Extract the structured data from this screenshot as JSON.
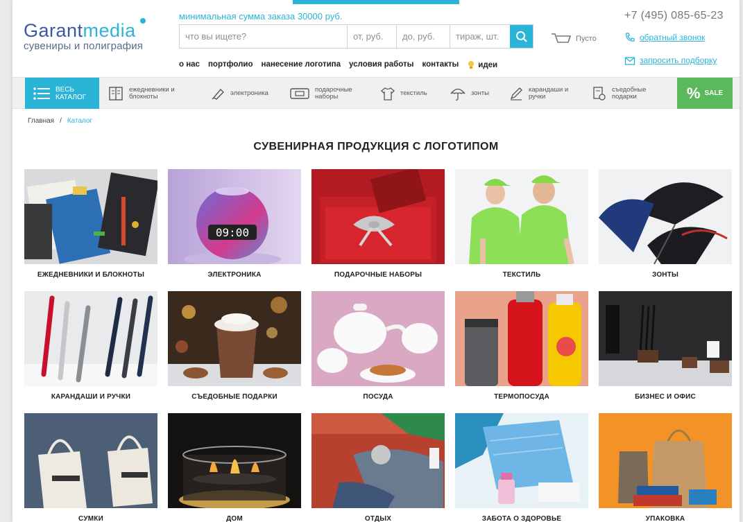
{
  "header": {
    "logo_brand_part1": "Garant",
    "logo_brand_part2": "media",
    "logo_tagline": "сувениры и полиграфия",
    "min_order": "минимальная сумма заказа 30000 руб.",
    "phone": "+7 (495) 085-65-23",
    "callback_link": "обратный звонок",
    "request_link": "запросить подборку",
    "cart_label": "Пусто"
  },
  "search": {
    "query_placeholder": "что вы ищете?",
    "price_from_placeholder": "от, руб.",
    "price_to_placeholder": "до, руб.",
    "quantity_placeholder": "тираж, шт."
  },
  "topnav": {
    "items": [
      "о нас",
      "портфолио",
      "нанесение логотипа",
      "условия работы",
      "контакты"
    ],
    "ideas_label": "идеи"
  },
  "catbar": {
    "all_catalog_line1": "ВЕСЬ",
    "all_catalog_line2": "КАТАЛОГ",
    "items": [
      {
        "line1": "ежедневники и",
        "line2": "блокноты",
        "icon": "notebook-icon"
      },
      {
        "line1": "электроника",
        "line2": "",
        "icon": "usb-icon"
      },
      {
        "line1": "подарочные",
        "line2": "наборы",
        "icon": "gift-box-icon"
      },
      {
        "line1": "текстиль",
        "line2": "",
        "icon": "tshirt-icon"
      },
      {
        "line1": "зонты",
        "line2": "",
        "icon": "umbrella-icon"
      },
      {
        "line1": "карандаши и",
        "line2": "ручки",
        "icon": "pen-icon"
      },
      {
        "line1": "съедобные",
        "line2": "подарки",
        "icon": "food-gift-icon"
      }
    ],
    "sale_percent": "%",
    "sale_label": "SALE"
  },
  "breadcrumb": {
    "home": "Главная",
    "separator": "/",
    "current": "Каталог"
  },
  "page_title": "СУВЕНИРНАЯ ПРОДУКЦИЯ С ЛОГОТИПОМ",
  "products": [
    {
      "caption": "ЕЖЕДНЕВНИКИ И БЛОКНОТЫ"
    },
    {
      "caption": "ЭЛЕКТРОНИКА",
      "display_text": "09:00"
    },
    {
      "caption": "ПОДАРОЧНЫЕ НАБОРЫ"
    },
    {
      "caption": "ТЕКСТИЛЬ"
    },
    {
      "caption": "ЗОНТЫ"
    },
    {
      "caption": "КАРАНДАШИ И РУЧКИ"
    },
    {
      "caption": "СЪЕДОБНЫЕ ПОДАРКИ"
    },
    {
      "caption": "ПОСУДА"
    },
    {
      "caption": "ТЕРМОПОСУДА"
    },
    {
      "caption": "БИЗНЕС И ОФИС"
    },
    {
      "caption": "СУМКИ"
    },
    {
      "caption": "ДОМ"
    },
    {
      "caption": "ОТДЫХ"
    },
    {
      "caption": "ЗАБОТА О ЗДОРОВЬЕ"
    },
    {
      "caption": "УПАКОВКА"
    }
  ],
  "colors": {
    "accent": "#2ab4d7",
    "brand_blue": "#3d57a4",
    "sale_green": "#5cb85c"
  }
}
